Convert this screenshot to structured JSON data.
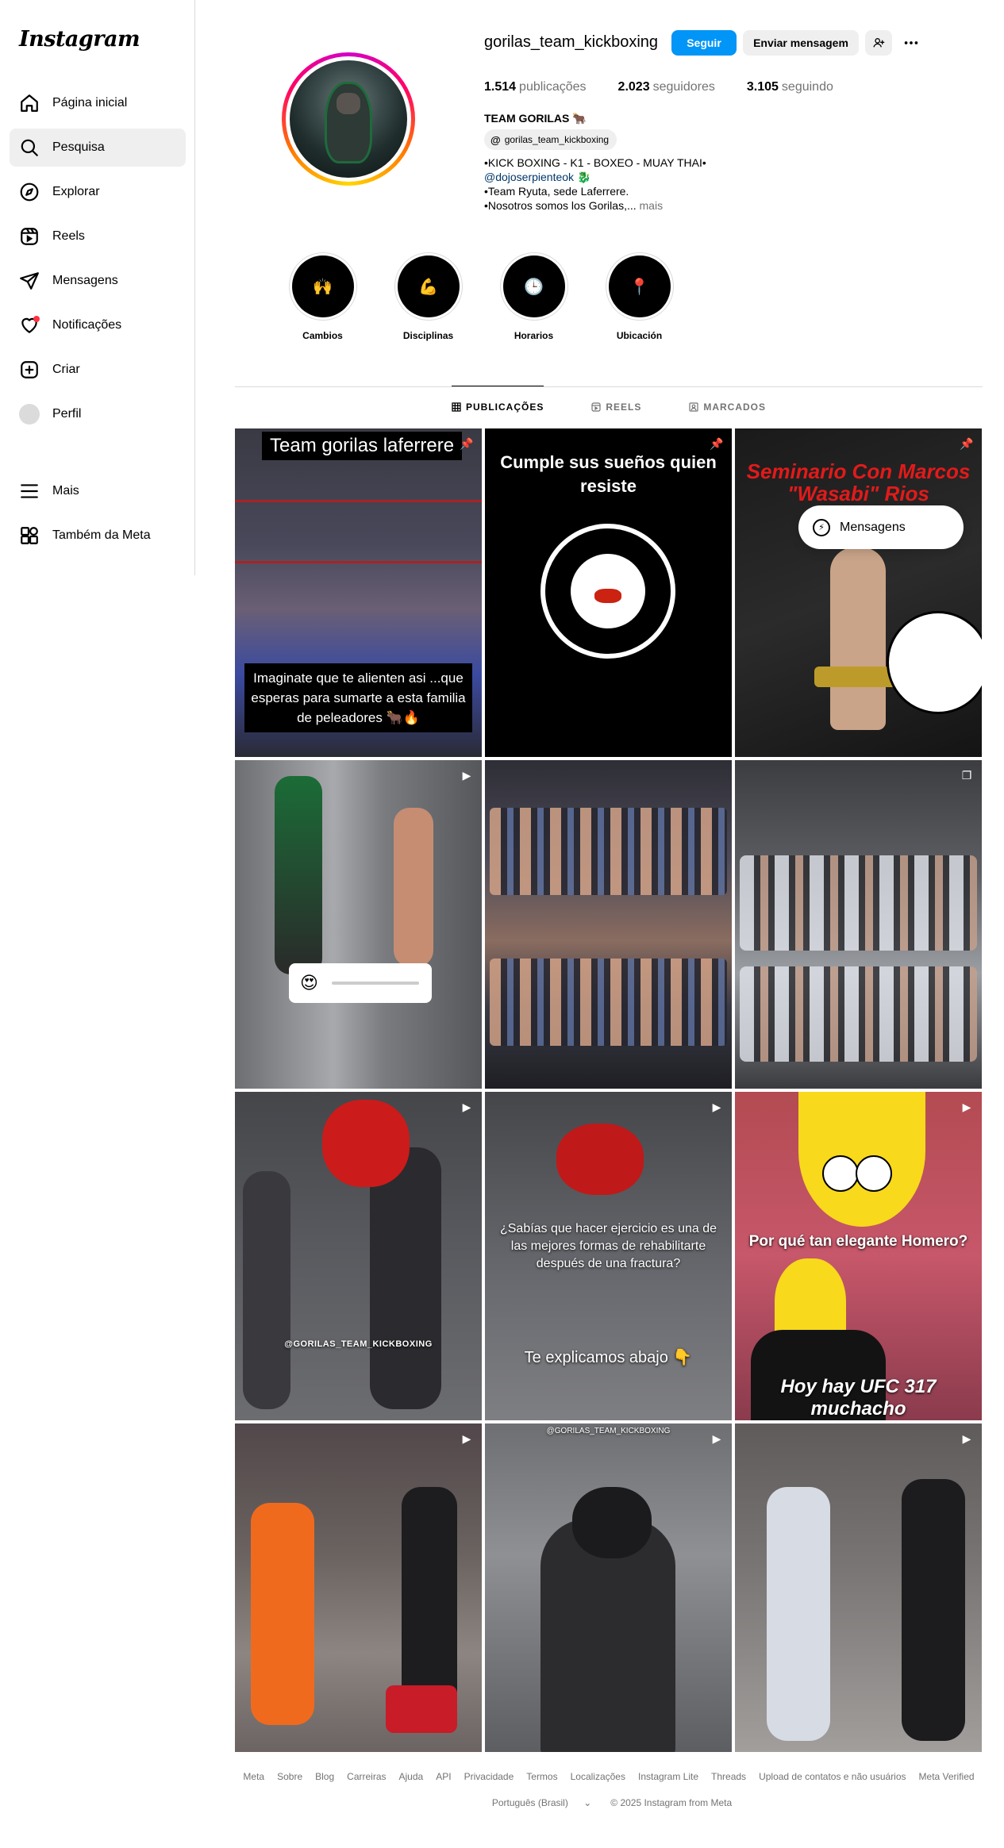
{
  "app": {
    "logo": "Instagram"
  },
  "sidebar": {
    "items": [
      {
        "label": "Página inicial",
        "icon": "home-icon"
      },
      {
        "label": "Pesquisa",
        "icon": "search-icon",
        "active": true
      },
      {
        "label": "Explorar",
        "icon": "compass-icon"
      },
      {
        "label": "Reels",
        "icon": "reels-icon"
      },
      {
        "label": "Mensagens",
        "icon": "send-icon"
      },
      {
        "label": "Notificações",
        "icon": "heart-icon",
        "badge": true
      },
      {
        "label": "Criar",
        "icon": "plus-square-icon"
      },
      {
        "label": "Perfil",
        "icon": "avatar"
      }
    ],
    "bottom": [
      {
        "label": "Mais",
        "icon": "menu-icon"
      },
      {
        "label": "Também da Meta",
        "icon": "meta-apps-icon"
      }
    ]
  },
  "profile": {
    "username": "gorilas_team_kickboxing",
    "follow_label": "Seguir",
    "message_label": "Enviar mensagem",
    "stats": {
      "posts_count": "1.514",
      "posts_label": "publicações",
      "followers_count": "2.023",
      "followers_label": "seguidores",
      "following_count": "3.105",
      "following_label": "seguindo"
    },
    "full_name": "TEAM GORILAS 🐂",
    "threads_handle": "gorilas_team_kickboxing",
    "bio_line1": "•KICK BOXING - K1 - BOXEO - MUAY THAI•",
    "bio_link": "@dojoserpienteok",
    "bio_link_emoji": "🐉",
    "bio_line3": "•Team Ryuta, sede Laferrere.",
    "bio_line4": "•Nosotros somos los Gorilas,...",
    "bio_more": "mais"
  },
  "highlights": [
    {
      "label": "Cambios",
      "emoji": "🙌"
    },
    {
      "label": "Disciplinas",
      "emoji": "💪"
    },
    {
      "label": "Horarios",
      "emoji": "🕒"
    },
    {
      "label": "Ubicación",
      "emoji": "📍"
    }
  ],
  "tabs": [
    {
      "label": "PUBLICAÇÕES",
      "active": true
    },
    {
      "label": "REELS"
    },
    {
      "label": "MARCADOS"
    }
  ],
  "posts": {
    "p1_title": "Team gorilas laferrere",
    "p1_caption": "Imaginate que te alienten asi ...que esperas para sumarte a esta familia de peleadores 🐂🔥",
    "p2_caption": "Cumple sus sueños quien resiste",
    "p3_caption": "Seminario Con Marcos \"Wasabi\" Rios",
    "p7_caption": "@GORILAS_TEAM_KICKBOXING",
    "p8_caption1": "¿Sabías que hacer ejercicio es una de las mejores formas de rehabilitarte después de una fractura?",
    "p8_caption2": "Te explicamos abajo 👇",
    "p9_caption1": "Por qué tan elegante Homero?",
    "p9_caption2": "Hoy hay UFC 317 muchacho",
    "p11_caption": "@GORILAS_TEAM_KICKBOXING"
  },
  "floating_messages": {
    "label": "Mensagens"
  },
  "footer": {
    "links": [
      "Meta",
      "Sobre",
      "Blog",
      "Carreiras",
      "Ajuda",
      "API",
      "Privacidade",
      "Termos",
      "Localizações",
      "Instagram Lite",
      "Threads",
      "Upload de contatos e não usuários",
      "Meta Verified"
    ],
    "language": "Português (Brasil)",
    "copyright": "© 2025 Instagram from Meta"
  },
  "colors": {
    "accent": "#0095f6",
    "notification": "#ff3040",
    "secondary_text": "#737373"
  }
}
